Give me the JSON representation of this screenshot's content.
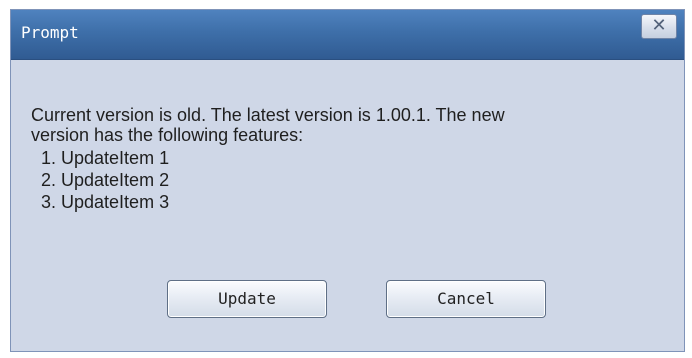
{
  "window": {
    "title": "Prompt",
    "close_icon": "close-icon"
  },
  "message": {
    "line1": "Current version is old. The latest version is 1.00.1. The new",
    "line2": "version has the following features:",
    "features": [
      "1. UpdateItem 1",
      "2. UpdateItem 2",
      "3. UpdateItem 3"
    ]
  },
  "buttons": {
    "update_label": "Update",
    "cancel_label": "Cancel"
  },
  "colors": {
    "titlebar": "#3e6fa9",
    "dialog_background": "#cfd7e7",
    "text": "#1f1f1f"
  }
}
